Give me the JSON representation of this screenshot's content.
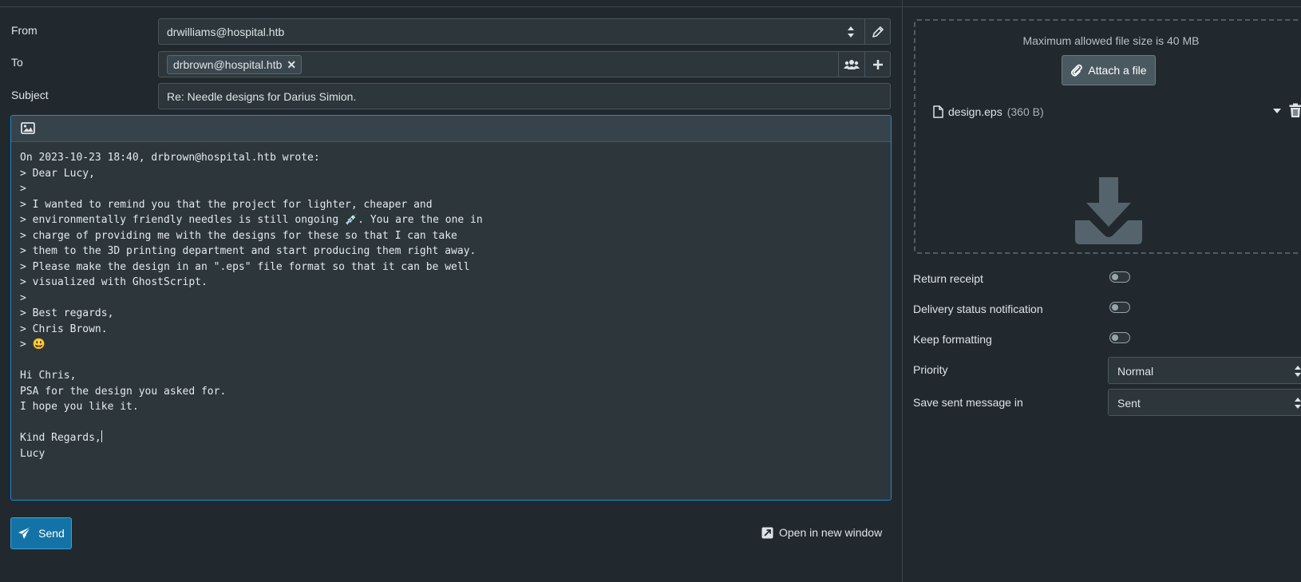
{
  "compose": {
    "from_label": "From",
    "from_value": "drwilliams@hospital.htb",
    "to_label": "To",
    "to_recipient": "drbrown@hospital.htb",
    "subject_label": "Subject",
    "subject_value": "Re: Needle designs for Darius Simion."
  },
  "body_lines": [
    "On 2023-10-23 18:40, drbrown@hospital.htb wrote:",
    "> Dear Lucy,",
    ">",
    "> I wanted to remind you that the project for lighter, cheaper and",
    "> environmentally friendly needles is still ongoing 💉. You are the one in",
    "> charge of providing me with the designs for these so that I can take",
    "> them to the 3D printing department and start producing them right away.",
    "> Please make the design in an \".eps\" file format so that it can be well",
    "> visualized with GhostScript.",
    ">",
    "> Best regards,",
    "> Chris Brown.",
    "> 😃",
    "",
    "Hi Chris,",
    "PSA for the design you asked for.",
    "I hope you like it.",
    "",
    "Kind Regards,",
    "Lucy"
  ],
  "actions": {
    "send_label": "Send",
    "open_new_window_label": "Open in new window"
  },
  "attachments": {
    "max_size_text": "Maximum allowed file size is 40 MB",
    "attach_button_label": "Attach a file",
    "items": [
      {
        "name": "design.eps",
        "size": "(360 B)"
      }
    ]
  },
  "options": {
    "return_receipt_label": "Return receipt",
    "return_receipt_on": false,
    "delivery_status_label": "Delivery status notification",
    "delivery_status_on": false,
    "keep_formatting_label": "Keep formatting",
    "keep_formatting_on": false,
    "priority_label": "Priority",
    "priority_value": "Normal",
    "save_sent_label": "Save sent message in",
    "save_sent_value": "Sent"
  },
  "colors": {
    "background": "#22292e",
    "accent": "#1373a6",
    "editor_border": "#1e8bcb"
  }
}
